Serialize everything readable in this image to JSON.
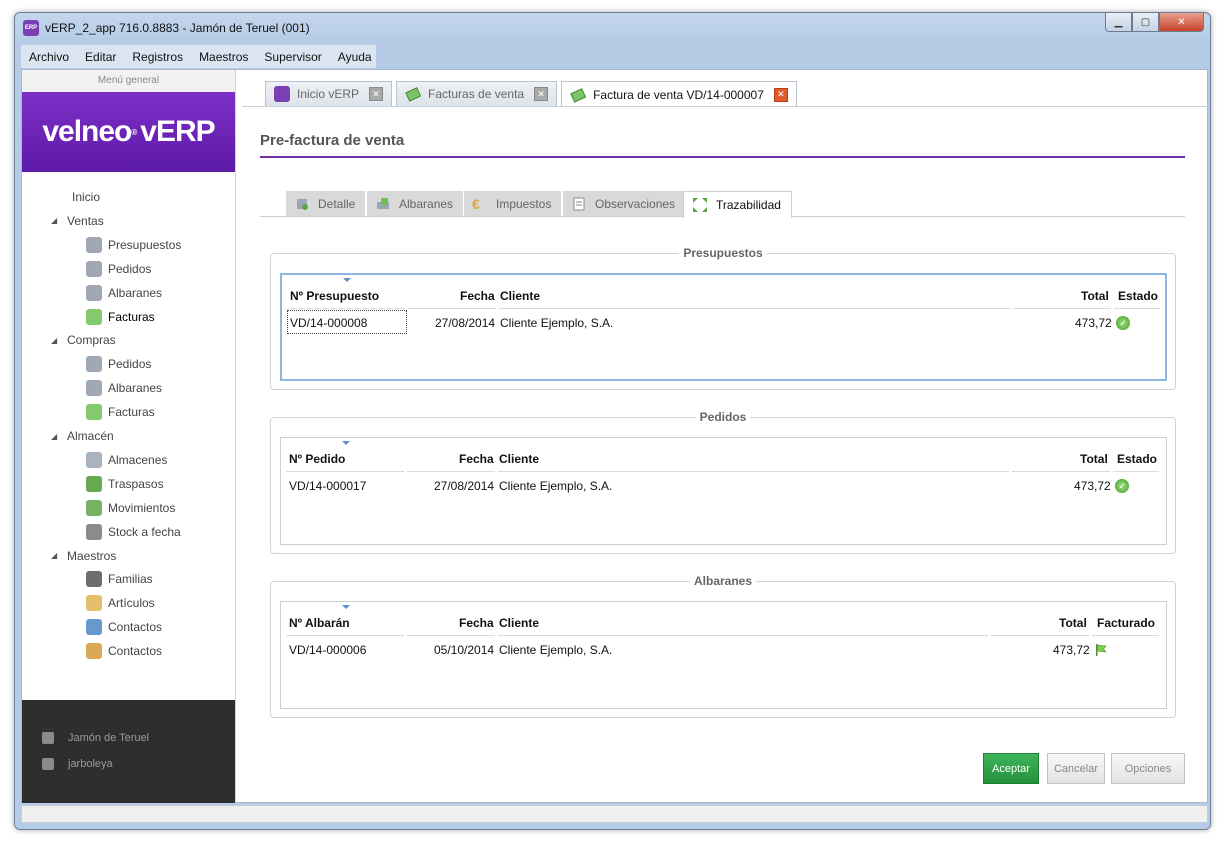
{
  "window": {
    "app_icon": "ERP",
    "title": "vERP_2_app 716.0.8883 - Jamón de Teruel (001)"
  },
  "menu": [
    "Archivo",
    "Editar",
    "Registros",
    "Maestros",
    "Supervisor",
    "Ayuda"
  ],
  "sidebar": {
    "header": "Menú general",
    "logo": "velneo",
    "logo_r": "®",
    "logo_suffix": "vERP",
    "items": [
      {
        "label": "Inicio",
        "level": 0,
        "arrow": "",
        "icon": "none"
      },
      {
        "label": "Ventas",
        "level": 0,
        "arrow": "◢",
        "icon": "none"
      },
      {
        "label": "Presupuestos",
        "level": 1,
        "arrow": "",
        "icon": "budget-icon"
      },
      {
        "label": "Pedidos",
        "level": 1,
        "arrow": "",
        "icon": "order-icon"
      },
      {
        "label": "Albaranes",
        "level": 1,
        "arrow": "",
        "icon": "delivery-note-icon"
      },
      {
        "label": "Facturas",
        "level": 1,
        "arrow": "",
        "icon": "invoice-icon",
        "active": true
      },
      {
        "label": "Compras",
        "level": 0,
        "arrow": "◢",
        "icon": "none"
      },
      {
        "label": "Pedidos",
        "level": 1,
        "arrow": "",
        "icon": "order-icon"
      },
      {
        "label": "Albaranes",
        "level": 1,
        "arrow": "",
        "icon": "delivery-note-icon"
      },
      {
        "label": "Facturas",
        "level": 1,
        "arrow": "",
        "icon": "invoice-icon"
      },
      {
        "label": "Almacén",
        "level": 0,
        "arrow": "◢",
        "icon": "none"
      },
      {
        "label": "Almacenes",
        "level": 1,
        "arrow": "",
        "icon": "warehouse-icon"
      },
      {
        "label": "Traspasos",
        "level": 1,
        "arrow": "",
        "icon": "transfer-icon"
      },
      {
        "label": "Movimientos",
        "level": 1,
        "arrow": "",
        "icon": "movements-icon"
      },
      {
        "label": "Stock a fecha",
        "level": 1,
        "arrow": "",
        "icon": "stock-icon"
      },
      {
        "label": "Maestros",
        "level": 0,
        "arrow": "◢",
        "icon": "none"
      },
      {
        "label": "Familias",
        "level": 1,
        "arrow": "",
        "icon": "families-icon"
      },
      {
        "label": "Artículos",
        "level": 1,
        "arrow": "",
        "icon": "box-icon"
      },
      {
        "label": "Contactos",
        "level": 1,
        "arrow": "",
        "icon": "contact-icon"
      },
      {
        "label": "Contactos",
        "level": 1,
        "arrow": "",
        "icon": "contact-edit-icon"
      }
    ],
    "bottom": {
      "company": "Jamón de Teruel",
      "user": "jarboleya"
    }
  },
  "doc_tabs": [
    {
      "label": "Inicio vERP",
      "active": false
    },
    {
      "label": "Facturas de venta",
      "active": false
    },
    {
      "label": "Factura de venta VD/14-000007",
      "active": true
    }
  ],
  "page_title": "Pre-factura de venta",
  "inner_tabs": [
    {
      "label": "Detalle",
      "active": false
    },
    {
      "label": "Albaranes",
      "active": false
    },
    {
      "label": "Impuestos",
      "active": false
    },
    {
      "label": "Observaciones",
      "active": false
    },
    {
      "label": "Trazabilidad",
      "active": true
    }
  ],
  "groups": {
    "presupuestos": {
      "title": "Presupuestos",
      "headers": {
        "num": "Nº Presupuesto",
        "fecha": "Fecha",
        "cliente": "Cliente",
        "total": "Total",
        "estado": "Estado"
      },
      "rows": [
        {
          "num": "VD/14-000008",
          "fecha": "27/08/2014",
          "cliente": "Cliente Ejemplo, S.A.",
          "total": "473,72",
          "estado": "ok"
        }
      ]
    },
    "pedidos": {
      "title": "Pedidos",
      "headers": {
        "num": "Nº Pedido",
        "fecha": "Fecha",
        "cliente": "Cliente",
        "total": "Total",
        "estado": "Estado"
      },
      "rows": [
        {
          "num": "VD/14-000017",
          "fecha": "27/08/2014",
          "cliente": "Cliente Ejemplo, S.A.",
          "total": "473,72",
          "estado": "ok"
        }
      ]
    },
    "albaranes": {
      "title": "Albaranes",
      "headers": {
        "num": "Nº Albarán",
        "fecha": "Fecha",
        "cliente": "Cliente",
        "total": "Total",
        "facturado": "Facturado"
      },
      "rows": [
        {
          "num": "VD/14-000006",
          "fecha": "05/10/2014",
          "cliente": "Cliente Ejemplo, S.A.",
          "total": "473,72",
          "facturado": "flag"
        }
      ]
    }
  },
  "buttons": {
    "accept": "Aceptar",
    "cancel": "Cancelar",
    "options": "Opciones"
  },
  "colors": {
    "accent": "#6d2fa8",
    "primary_button": "#2fa349",
    "close": "#c7432a"
  }
}
